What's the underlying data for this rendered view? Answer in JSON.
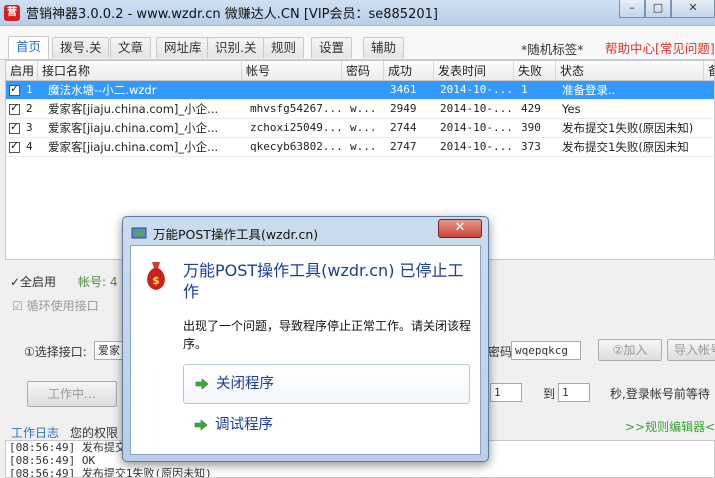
{
  "window": {
    "title": "营销神器3.0.0.2 - www.wzdr.cn 微赚达人.CN [VIP会员：se885201]",
    "app_icon_glyph": "营",
    "minimize": "–",
    "maximize": "□",
    "close": "✕"
  },
  "tabs": [
    "首页",
    "拨号.关",
    "文章",
    "网址库",
    "识别.关",
    "规则",
    "设置",
    "辅助"
  ],
  "random_tag": "*随机标签*",
  "help_link": "帮助中心[常见问题]",
  "table": {
    "headers": [
      "启用",
      "接口名称",
      "帐号",
      "密码",
      "成功",
      "发表时间",
      "失败",
      "状态",
      "备"
    ],
    "rows": [
      {
        "idx": "1",
        "name": "魔法水塘--小二.wzdr",
        "account": "",
        "password": "",
        "success": "3461",
        "time": "2014-10-...",
        "fail": "1",
        "status": "准备登录..",
        "selected": true
      },
      {
        "idx": "2",
        "name": "爱家客[jiaju.china.com]_小企...",
        "account": "mhvsfg54267...",
        "password": "w...",
        "success": "2949",
        "time": "2014-10-...",
        "fail": "429",
        "status": "Yes",
        "selected": false
      },
      {
        "idx": "3",
        "name": "爱家客[jiaju.china.com]_小企...",
        "account": "zchoxi25049...",
        "password": "w...",
        "success": "2744",
        "time": "2014-10-...",
        "fail": "390",
        "status": "发布提交1失败(原因未知)",
        "selected": false
      },
      {
        "idx": "4",
        "name": "爱家客[jiaju.china.com]_小企...",
        "account": "qkecyb63802...",
        "password": "w...",
        "success": "2747",
        "time": "2014-10-...",
        "fail": "373",
        "status": "发布提交1失败(原因未知",
        "selected": false
      }
    ]
  },
  "lower": {
    "enable_all": "✓全启用",
    "account_label": "帐号: 4",
    "loop_label": "循环使用接口",
    "select_iface": "①选择接口:",
    "select_iface_value": "爱家",
    "password_label": "密码:",
    "password_value": "wqepqkcg",
    "add_button": "②加入",
    "import_button": "导入帐号",
    "working_button": "工作中…",
    "spinner_from": "1",
    "to_label": "到",
    "spinner_to": "1",
    "wait_label": "秒,登录帐号前等待",
    "rules_editor": ">>规则编辑器<<",
    "log_tab": "工作日志",
    "perm_tab": "您的权限",
    "log_lines": [
      "[08:56:49] 发布提交",
      "[08:56:49] OK",
      "[08:56:49] 发布提交1失败(原因未知)"
    ]
  },
  "dialog": {
    "title": "万能POST操作工具(wzdr.cn)",
    "close": "✕",
    "heading": "万能POST操作工具(wzdr.cn) 已停止工作",
    "message": "出现了一个问题，导致程序停止正常工作。请关闭该程序。",
    "close_program": "关闭程序",
    "debug_program": "调试程序"
  }
}
